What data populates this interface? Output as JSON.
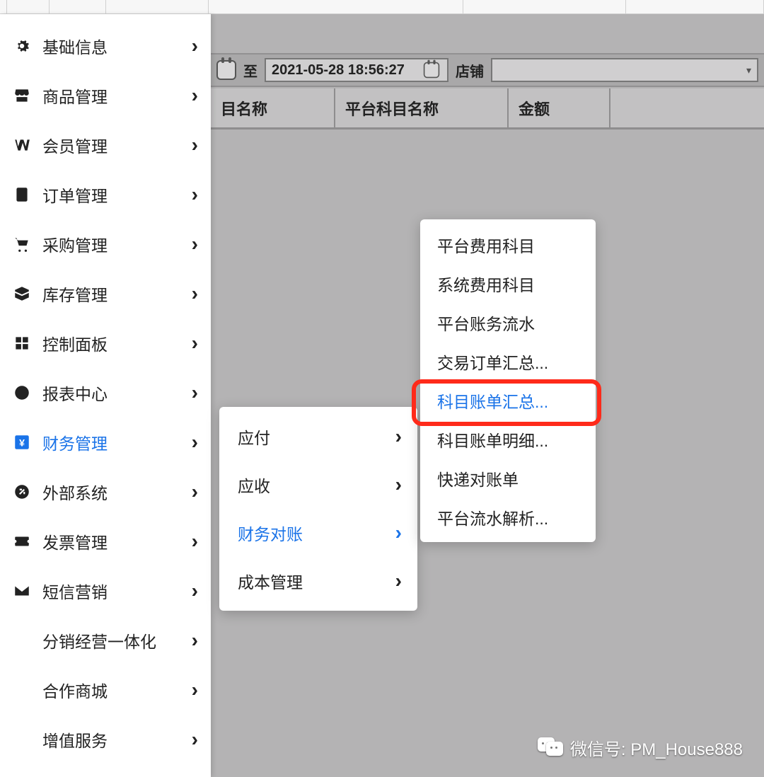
{
  "sidebar": {
    "items": [
      {
        "label": "基础信息"
      },
      {
        "label": "商品管理"
      },
      {
        "label": "会员管理"
      },
      {
        "label": "订单管理"
      },
      {
        "label": "采购管理"
      },
      {
        "label": "库存管理"
      },
      {
        "label": "控制面板"
      },
      {
        "label": "报表中心"
      },
      {
        "label": "财务管理"
      },
      {
        "label": "外部系统"
      },
      {
        "label": "发票管理"
      },
      {
        "label": "短信营销"
      }
    ],
    "subs": [
      {
        "label": "分销经营一体化"
      },
      {
        "label": "合作商城"
      },
      {
        "label": "增值服务"
      }
    ]
  },
  "filter": {
    "to_label": "至",
    "date_value": "2021-05-28 18:56:27",
    "store_label": "店铺"
  },
  "headers": {
    "c1": "目名称",
    "c2": "平台科目名称",
    "c3": "金额"
  },
  "submenu1": {
    "items": [
      {
        "label": "应付"
      },
      {
        "label": "应收"
      },
      {
        "label": "财务对账"
      },
      {
        "label": "成本管理"
      }
    ]
  },
  "submenu2": {
    "items": [
      {
        "label": "平台费用科目"
      },
      {
        "label": "系统费用科目"
      },
      {
        "label": "平台账务流水"
      },
      {
        "label": "交易订单汇总..."
      },
      {
        "label": "科目账单汇总..."
      },
      {
        "label": "科目账单明细..."
      },
      {
        "label": "快递对账单"
      },
      {
        "label": "平台流水解析..."
      }
    ]
  },
  "watermark": {
    "text": "微信号: PM_House888"
  }
}
